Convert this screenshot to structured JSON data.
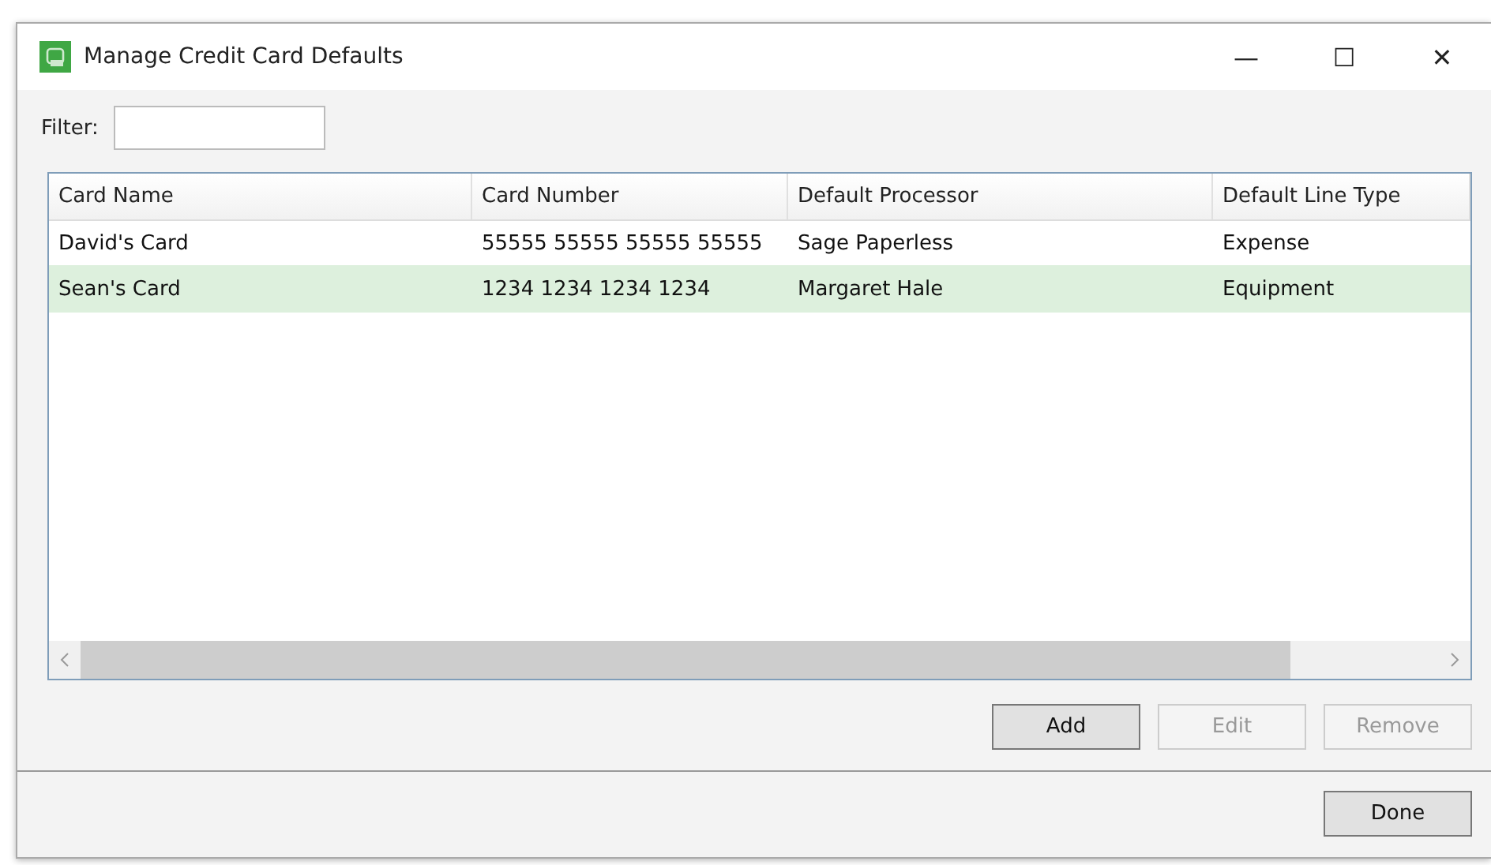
{
  "window": {
    "title": "Manage Credit Card Defaults",
    "controls": [
      "—",
      "☐",
      "✕"
    ]
  },
  "filter": {
    "label": "Filter:"
  },
  "table": {
    "columns": [
      "Card Name",
      "Card Number",
      "Default Processor",
      "Default Line Type"
    ],
    "rows": [
      {
        "cells": [
          "David's Card",
          "55555 55555 55555 55555",
          "Sage Paperless",
          "Expense"
        ],
        "selected": false
      },
      {
        "cells": [
          "Sean's Card",
          "1234 1234 1234 1234",
          "Margaret Hale",
          "Equipment"
        ],
        "selected": true
      }
    ]
  },
  "buttons": [
    {
      "label": "Add",
      "disabled": false
    },
    {
      "label": "Edit",
      "disabled": true
    },
    {
      "label": "Remove",
      "disabled": true
    }
  ],
  "footer_button": {
    "label": "Done",
    "disabled": false
  }
}
